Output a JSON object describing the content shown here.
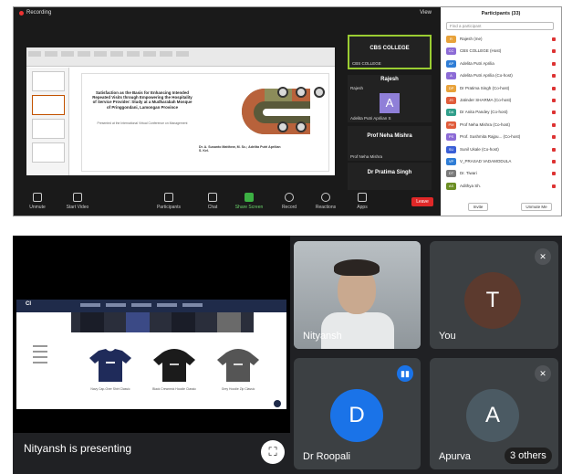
{
  "zoom": {
    "recording": "Recording",
    "tool_label": "View",
    "slide": {
      "title": "Satisfaction as the Basis for Enhancing Intended Repeated Visits through Empowering the Hospitality of Service Provider: Study at a Mudharabah Mosque of Pringgondani, Lamongan Province",
      "subtitle": "Presented at the International Virtual Conference on Management",
      "authors": "Dr. A. Susanto Matthew, M. Sc.; Adelita Putri Aprilian S. Kel."
    },
    "gallery": [
      {
        "name": "CBS COLLEGE",
        "label": "CBS COLLEGE"
      },
      {
        "name": "Rajesh",
        "label": "Rajesh",
        "avatar": "A",
        "sub": "Adelita Putri Aprilian S"
      },
      {
        "name": "Prof Neha Mishra",
        "label": "Prof Neha Mishra"
      },
      {
        "name": "Dr Pratima Singh",
        "label": "Dr Pratima Singh"
      }
    ],
    "toolbar": {
      "unmute": "Unmute",
      "start_video": "Start Video",
      "participants": "Participants",
      "chat": "Chat",
      "share_screen": "Share Screen",
      "record": "Record",
      "reactions": "Reactions",
      "apps": "Apps",
      "end": "Leave",
      "participants_count": "33"
    },
    "panel": {
      "title": "Participants (33)",
      "search_placeholder": "Find a participant",
      "participants": [
        {
          "initials": "R",
          "name": "Rajesh (me)",
          "color": "#e8a23a"
        },
        {
          "initials": "CC",
          "name": "CBS COLLEGE (Host)",
          "color": "#8c6bd6"
        },
        {
          "initials": "AP",
          "name": "Adelita Putri Aprilia",
          "color": "#2f7dd6"
        },
        {
          "initials": "A",
          "name": "Adelita Putri Aprilia (Co-host)",
          "color": "#8c6bd6"
        },
        {
          "initials": "DP",
          "name": "Dr Pratima Singh (Co-host)",
          "color": "#e8a23a"
        },
        {
          "initials": "JS",
          "name": "Jatinder SHARMA (Co-host)",
          "color": "#e05b3a"
        },
        {
          "initials": "DA",
          "name": "Dr Anita Pandey (Co-host)",
          "color": "#2f9e8a"
        },
        {
          "initials": "PM",
          "name": "Prof Neha Mishra (Co-host)",
          "color": "#e05b3a"
        },
        {
          "initials": "PS",
          "name": "Prof. Sushmita Rajpu... (Co-host)",
          "color": "#8c6bd6"
        },
        {
          "initials": "SU",
          "name": "Sunil Ukale (Co-host)",
          "color": "#3a5fd6"
        },
        {
          "initials": "VP",
          "name": "V_PRASAD VADAMODULA",
          "color": "#2f7dd6"
        },
        {
          "initials": "DT",
          "name": "Dr. Tiwari",
          "color": "#7a7a7a"
        },
        {
          "initials": "AS",
          "name": "Adithya Sh.",
          "color": "#6b8e23"
        }
      ],
      "invite": "Invite",
      "unmute_me": "Unmute Me"
    }
  },
  "meet": {
    "presenting_text": "Nityansh is presenting",
    "shared_site": {
      "logo": "CI",
      "products": [
        "Navy Cap-Over Shirt Classic",
        "Black Crewneck Hoodie Classic",
        "Grey Hoodie Zip Classic"
      ]
    },
    "participants": [
      {
        "name": "Nityansh",
        "type": "camera"
      },
      {
        "name": "You",
        "initial": "T",
        "color": "#5c3a2e"
      },
      {
        "name": "Dr Roopali",
        "initial": "D",
        "color": "#1a73e8"
      },
      {
        "name": "Apurva",
        "initial": "A",
        "color": "#4b5a63"
      }
    ],
    "others": "3 others",
    "colors": {
      "background": "#202124",
      "tile": "#3c4043",
      "accent_blue": "#1a73e8"
    }
  }
}
